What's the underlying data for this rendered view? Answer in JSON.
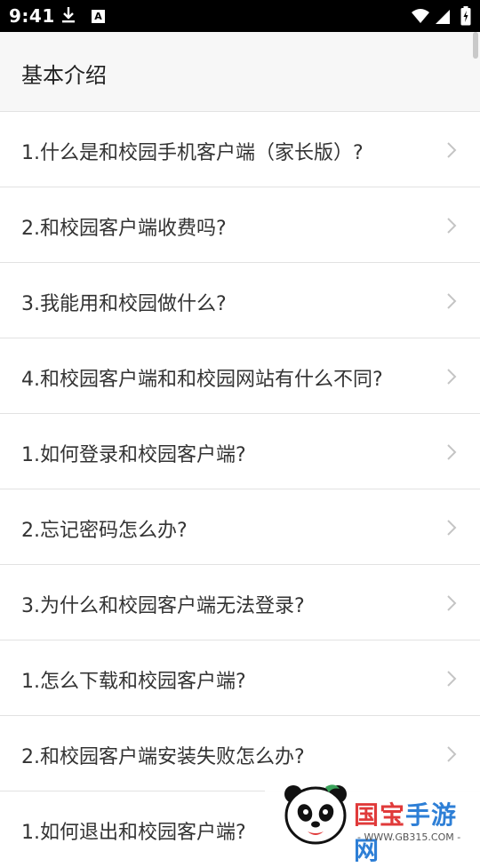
{
  "status_bar": {
    "time": "9:41",
    "icons": [
      "download-icon",
      "a-badge-icon",
      "wifi-icon",
      "signal-icon",
      "battery-icon"
    ]
  },
  "header": {
    "title": "基本介绍"
  },
  "faq": [
    "1.什么是和校园手机客户端（家长版）?",
    "2.和校园客户端收费吗?",
    "3.我能用和校园做什么?",
    "4.和校园客户端和和校园网站有什么不同?",
    "1.如何登录和校园客户端?",
    "2.忘记密码怎么办?",
    "3.为什么和校园客户端无法登录?",
    "1.怎么下载和校园客户端?",
    "2.和校园客户端安装失败怎么办?",
    "1.如何退出和校园客户端?"
  ],
  "watermark": {
    "name_part1": "国宝",
    "name_part2": "手游网",
    "url": "- WWW.GB315.COM -"
  },
  "colors": {
    "header_bg": "#f7f7f7",
    "divider": "#e2e2e2",
    "text": "#333333",
    "chevron": "#c4c4c4"
  }
}
